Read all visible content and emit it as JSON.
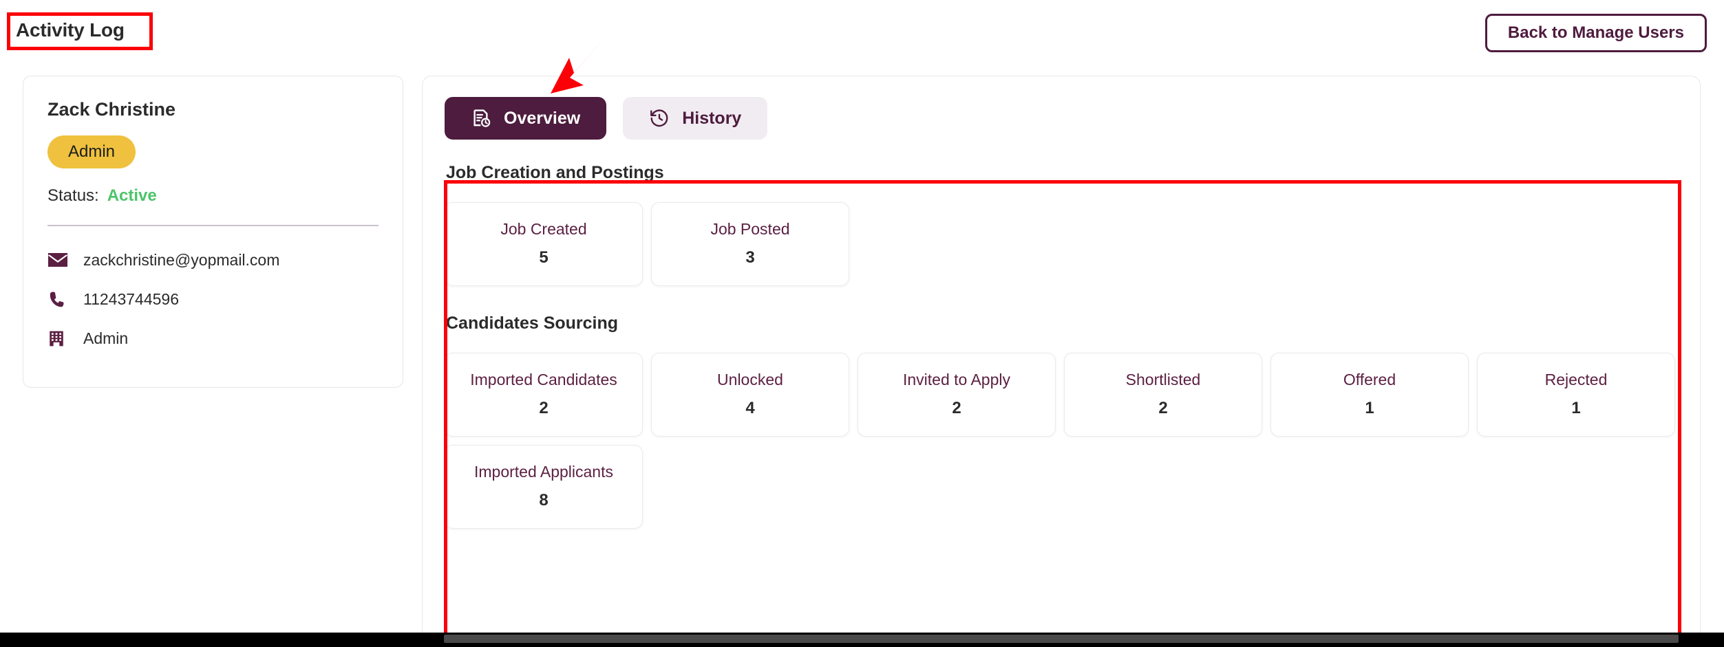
{
  "header": {
    "title": "Activity Log",
    "back_button_label": "Back to Manage Users"
  },
  "profile": {
    "name": "Zack Christine",
    "role_badge": "Admin",
    "status_label": "Status:",
    "status_value": "Active",
    "status_color": "#4cc46a",
    "badge_color": "#efc13e",
    "contacts": [
      {
        "icon": "envelope-icon",
        "value": "zackchristine@yopmail.com"
      },
      {
        "icon": "phone-icon",
        "value": "11243744596"
      },
      {
        "icon": "building-icon",
        "value": "Admin"
      }
    ]
  },
  "tabs": [
    {
      "label": "Overview",
      "icon": "document-clock-icon",
      "active": true
    },
    {
      "label": "History",
      "icon": "clock-rewind-icon",
      "active": false
    }
  ],
  "sections": [
    {
      "title": "Job Creation and Postings",
      "cards": [
        {
          "label": "Job Created",
          "value": "5"
        },
        {
          "label": "Job Posted",
          "value": "3"
        }
      ]
    },
    {
      "title": "Candidates Sourcing",
      "cards": [
        {
          "label": "Imported Candidates",
          "value": "2"
        },
        {
          "label": "Unlocked",
          "value": "4"
        },
        {
          "label": "Invited to Apply",
          "value": "2"
        },
        {
          "label": "Shortlisted",
          "value": "2"
        },
        {
          "label": "Offered",
          "value": "1"
        },
        {
          "label": "Rejected",
          "value": "1"
        },
        {
          "label": "Imported Applicants",
          "value": "8"
        }
      ]
    }
  ],
  "theme": {
    "accent_purple": "#4d1c3e",
    "accent_purple_text": "#5b1f42",
    "annotation_red": "#fb0007",
    "tab_inactive_bg": "#f1ecf1"
  }
}
